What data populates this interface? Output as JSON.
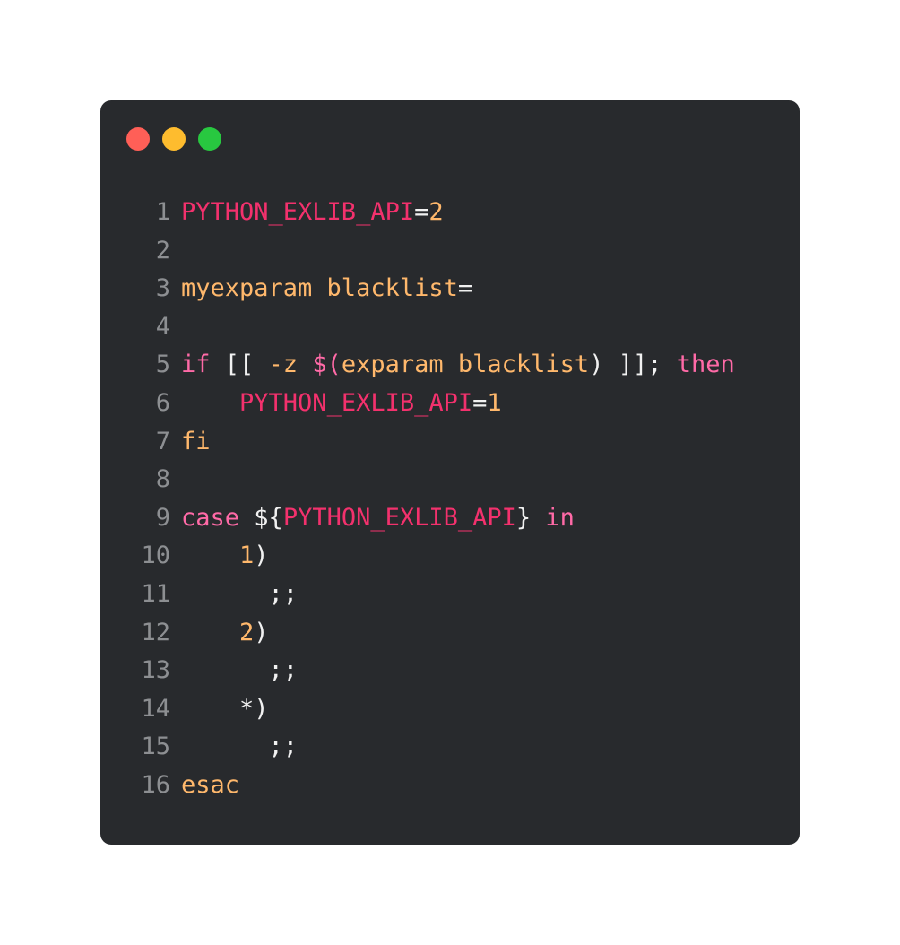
{
  "window": {
    "buttons": [
      {
        "name": "close",
        "color": "#ff5f57"
      },
      {
        "name": "minimize",
        "color": "#febc2e"
      },
      {
        "name": "maximize",
        "color": "#28c840"
      }
    ]
  },
  "theme": {
    "background": "#282a2d",
    "line_number": "#8d8f92",
    "plain": "#f1f1f1",
    "variable": "#f3316d",
    "keyword": "#ff6aa7",
    "command": "#ffb86c",
    "number": "#ffb86c"
  },
  "code": {
    "language": "bash",
    "lines": [
      {
        "n": "1",
        "tokens": [
          {
            "t": "PYTHON_EXLIB_API",
            "c": "variable"
          },
          {
            "t": "=",
            "c": "plain"
          },
          {
            "t": "2",
            "c": "number"
          }
        ]
      },
      {
        "n": "2",
        "tokens": []
      },
      {
        "n": "3",
        "tokens": [
          {
            "t": "myexparam blacklist",
            "c": "command"
          },
          {
            "t": "=",
            "c": "plain"
          }
        ]
      },
      {
        "n": "4",
        "tokens": []
      },
      {
        "n": "5",
        "tokens": [
          {
            "t": "if",
            "c": "keyword"
          },
          {
            "t": " [[ ",
            "c": "plain"
          },
          {
            "t": "-z",
            "c": "command"
          },
          {
            "t": " ",
            "c": "plain"
          },
          {
            "t": "$(",
            "c": "keyword"
          },
          {
            "t": "exparam blacklist",
            "c": "command"
          },
          {
            "t": ") ]]; ",
            "c": "plain"
          },
          {
            "t": "then",
            "c": "keyword"
          }
        ]
      },
      {
        "n": "6",
        "tokens": [
          {
            "t": "    ",
            "c": "plain"
          },
          {
            "t": "PYTHON_EXLIB_API",
            "c": "variable"
          },
          {
            "t": "=",
            "c": "plain"
          },
          {
            "t": "1",
            "c": "number"
          }
        ]
      },
      {
        "n": "7",
        "tokens": [
          {
            "t": "fi",
            "c": "command"
          }
        ]
      },
      {
        "n": "8",
        "tokens": []
      },
      {
        "n": "9",
        "tokens": [
          {
            "t": "case",
            "c": "keyword"
          },
          {
            "t": " ${",
            "c": "plain"
          },
          {
            "t": "PYTHON_EXLIB_API",
            "c": "variable"
          },
          {
            "t": "} ",
            "c": "plain"
          },
          {
            "t": "in",
            "c": "keyword"
          }
        ]
      },
      {
        "n": "10",
        "tokens": [
          {
            "t": "    ",
            "c": "plain"
          },
          {
            "t": "1",
            "c": "number"
          },
          {
            "t": ")",
            "c": "plain"
          }
        ]
      },
      {
        "n": "11",
        "tokens": [
          {
            "t": "      ;;",
            "c": "plain"
          }
        ]
      },
      {
        "n": "12",
        "tokens": [
          {
            "t": "    ",
            "c": "plain"
          },
          {
            "t": "2",
            "c": "number"
          },
          {
            "t": ")",
            "c": "plain"
          }
        ]
      },
      {
        "n": "13",
        "tokens": [
          {
            "t": "      ;;",
            "c": "plain"
          }
        ]
      },
      {
        "n": "14",
        "tokens": [
          {
            "t": "    *)",
            "c": "plain"
          }
        ]
      },
      {
        "n": "15",
        "tokens": [
          {
            "t": "      ;;",
            "c": "plain"
          }
        ]
      },
      {
        "n": "16",
        "tokens": [
          {
            "t": "esac",
            "c": "command"
          }
        ]
      }
    ]
  }
}
